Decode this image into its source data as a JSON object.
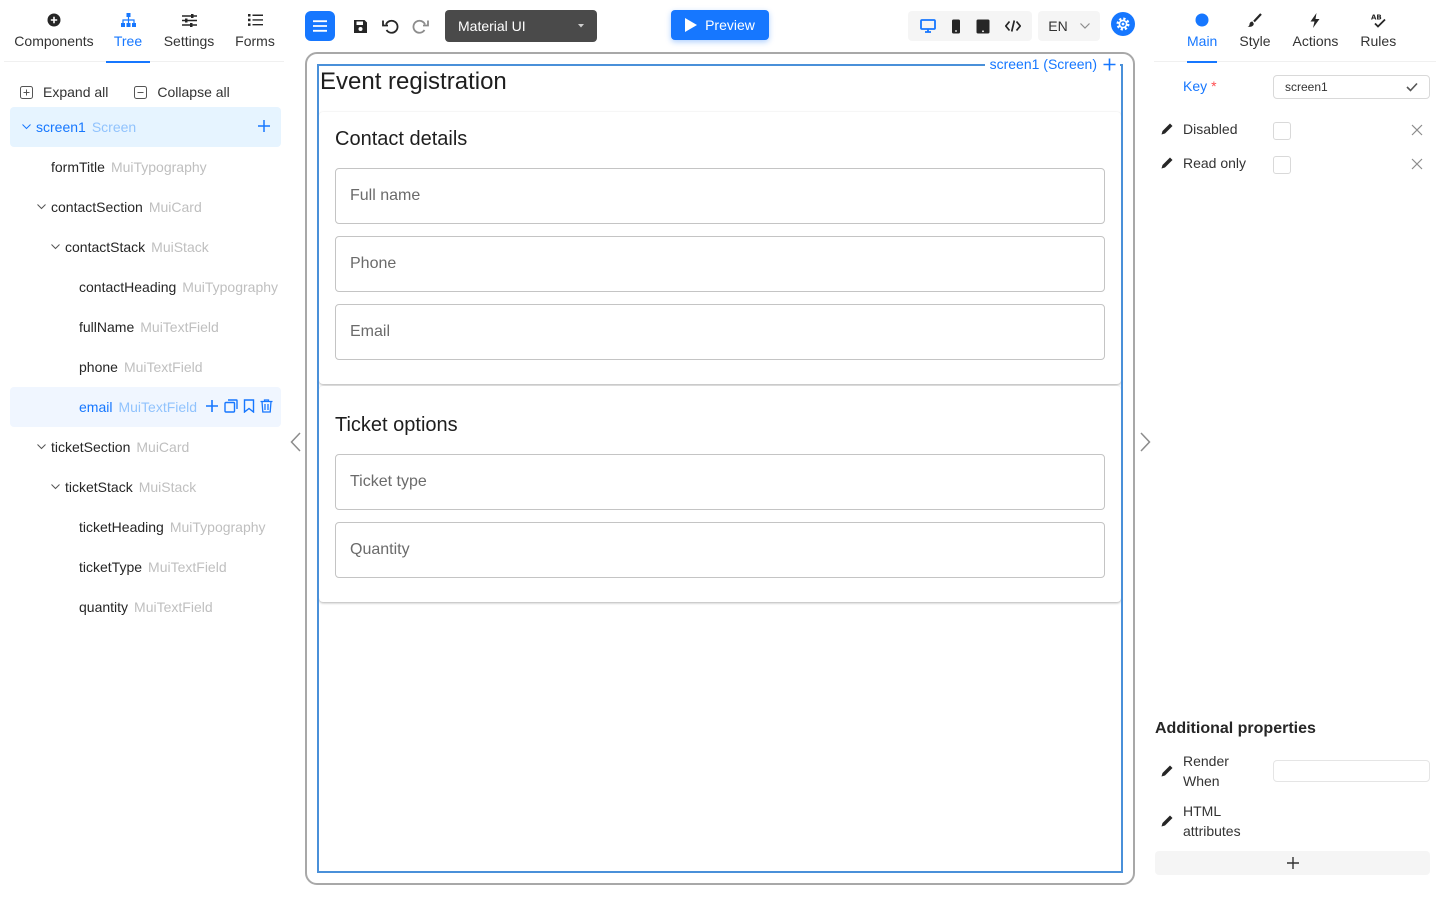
{
  "left_tabs": [
    {
      "label": "Components",
      "icon": "plus-circle-icon"
    },
    {
      "label": "Tree",
      "icon": "tree-icon"
    },
    {
      "label": "Settings",
      "icon": "sliders-icon"
    },
    {
      "label": "Forms",
      "icon": "list-icon"
    }
  ],
  "active_left_tab": "Tree",
  "tree_controls": {
    "expand_all": "Expand all",
    "collapse_all": "Collapse all"
  },
  "tree": [
    {
      "name": "screen1",
      "type": "Screen"
    },
    {
      "name": "formTitle",
      "type": "MuiTypography"
    },
    {
      "name": "contactSection",
      "type": "MuiCard"
    },
    {
      "name": "contactStack",
      "type": "MuiStack"
    },
    {
      "name": "contactHeading",
      "type": "MuiTypography"
    },
    {
      "name": "fullName",
      "type": "MuiTextField"
    },
    {
      "name": "phone",
      "type": "MuiTextField"
    },
    {
      "name": "email",
      "type": "MuiTextField"
    },
    {
      "name": "ticketSection",
      "type": "MuiCard"
    },
    {
      "name": "ticketStack",
      "type": "MuiStack"
    },
    {
      "name": "ticketHeading",
      "type": "MuiTypography"
    },
    {
      "name": "ticketType",
      "type": "MuiTextField"
    },
    {
      "name": "quantity",
      "type": "MuiTextField"
    }
  ],
  "toolbar": {
    "theme": "Material UI",
    "preview": "Preview",
    "language": "EN"
  },
  "canvas": {
    "screen_label": "screen1 (Screen)",
    "form_title": "Event registration",
    "contact": {
      "heading": "Contact details",
      "fields": [
        "Full name",
        "Phone",
        "Email"
      ]
    },
    "ticket": {
      "heading": "Ticket options",
      "fields": [
        "Ticket type",
        "Quantity"
      ]
    }
  },
  "right_tabs": [
    {
      "label": "Main",
      "icon": "circle-icon"
    },
    {
      "label": "Style",
      "icon": "brush-icon"
    },
    {
      "label": "Actions",
      "icon": "lightning-icon"
    },
    {
      "label": "Rules",
      "icon": "spellcheck-icon"
    }
  ],
  "active_right_tab": "Main",
  "properties": {
    "key_label": "Key",
    "key_required": "*",
    "key_value": "screen1",
    "disabled": "Disabled",
    "read_only": "Read only",
    "additional_title": "Additional properties",
    "render_when": "Render When",
    "html_attributes": "HTML attributes"
  },
  "colors": {
    "accent": "#1677ff",
    "outline": "#4a90d9"
  }
}
